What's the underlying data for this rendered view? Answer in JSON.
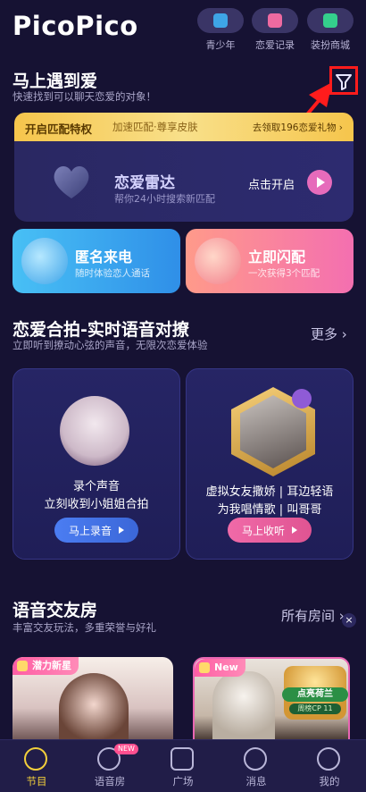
{
  "app": {
    "logo": "PicoPico"
  },
  "header": {
    "buttons": [
      {
        "label": "青少年",
        "icon": "shield-star-icon",
        "color": "#3ea5e6"
      },
      {
        "label": "恋爱记录",
        "icon": "love-record-icon",
        "color": "#ee6aa0"
      },
      {
        "label": "装扮商城",
        "icon": "gift-shop-icon",
        "color": "#34cf8c"
      }
    ]
  },
  "meet": {
    "title": "马上遇到爱",
    "subtitle": "快速找到可以聊天恋爱的对象！",
    "filter_icon": "filter-funnel-icon"
  },
  "banner": {
    "left": "开启匹配特权",
    "mid": "加速匹配·尊享皮肤",
    "right": "去领取196恋爱礼物 ›"
  },
  "radar": {
    "title": "恋爱雷达",
    "subtitle": "帮你24小时搜索新匹配",
    "action": "点击开启"
  },
  "cards": [
    {
      "title": "匿名来电",
      "subtitle": "随时体验恋人通话",
      "icon": "moon-cloud-icon"
    },
    {
      "title": "立即闪配",
      "subtitle": "一次获得3个匹配",
      "icon": "bubble-chat-icon"
    }
  ],
  "duet_section": {
    "title": "恋爱合拍-实时语音对撩",
    "subtitle": "立即听到撩动心弦的声音，无限次恋爱体验",
    "more": "更多 ›",
    "cards": [
      {
        "line1": "录个声音",
        "line2": "立刻收到小姐姐合拍",
        "button": "马上录音"
      },
      {
        "line1": "虚拟女友撒娇 | 耳边轻语",
        "line2": "为我唱情歌 | 叫哥哥",
        "button": "马上收听"
      }
    ]
  },
  "rooms": {
    "title": "语音交友房",
    "subtitle": "丰富交友玩法，多重荣誉与好礼",
    "more": "所有房间 ›",
    "items": [
      {
        "tag": "潜力新星"
      },
      {
        "tag": "New",
        "badge_title": "点亮荷兰",
        "badge_sub": "周榜CP 11"
      }
    ]
  },
  "nav": {
    "items": [
      {
        "label": "节目",
        "active": true,
        "icon": "program-icon"
      },
      {
        "label": "语音房",
        "badge": "NEW",
        "icon": "voice-room-icon"
      },
      {
        "label": "广场",
        "icon": "square-icon"
      },
      {
        "label": "消息",
        "icon": "message-icon"
      },
      {
        "label": "我的",
        "icon": "profile-icon"
      }
    ]
  }
}
